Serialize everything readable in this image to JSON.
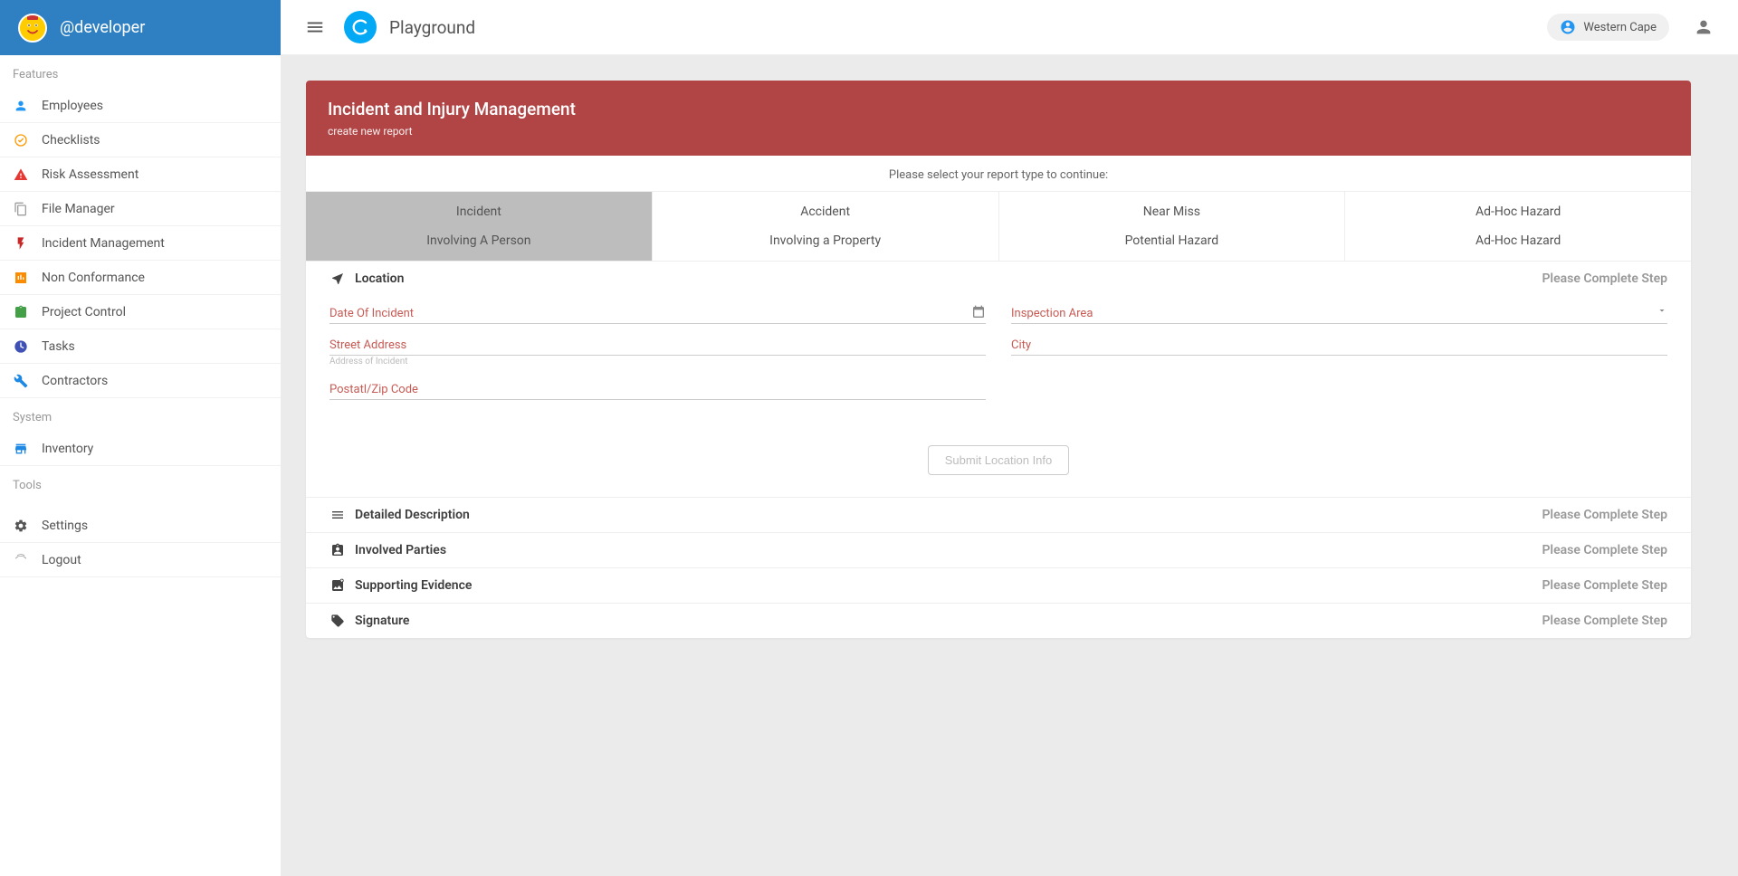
{
  "sidebar": {
    "username": "@developer",
    "sections": {
      "features_label": "Features",
      "system_label": "System",
      "tools_label": "Tools"
    },
    "items": {
      "employees": "Employees",
      "checklists": "Checklists",
      "risk": "Risk Assessment",
      "files": "File Manager",
      "incident": "Incident Management",
      "nonconf": "Non Conformance",
      "project": "Project Control",
      "tasks": "Tasks",
      "contractors": "Contractors",
      "inventory": "Inventory",
      "settings": "Settings",
      "logout": "Logout"
    }
  },
  "topbar": {
    "app_title": "Playground",
    "region": "Western Cape"
  },
  "card": {
    "title": "Incident and Injury Management",
    "subtitle": "create new report",
    "instruction": "Please select your report type to continue:"
  },
  "types": [
    {
      "title": "Incident",
      "sub": "Involving A Person"
    },
    {
      "title": "Accident",
      "sub": "Involving a Property"
    },
    {
      "title": "Near Miss",
      "sub": "Potential Hazard"
    },
    {
      "title": "Ad-Hoc Hazard",
      "sub": "Ad-Hoc Hazard"
    }
  ],
  "steps": {
    "location": {
      "title": "Location",
      "status": "Please Complete Step"
    },
    "description": {
      "title": "Detailed Description",
      "status": "Please Complete Step"
    },
    "parties": {
      "title": "Involved Parties",
      "status": "Please Complete Step"
    },
    "evidence": {
      "title": "Supporting Evidence",
      "status": "Please Complete Step"
    },
    "signature": {
      "title": "Signature",
      "status": "Please Complete Step"
    }
  },
  "form": {
    "date_label": "Date Of Incident",
    "area_label": "Inspection Area",
    "street_label": "Street Address",
    "street_helper": "Address of Incident",
    "city_label": "City",
    "zip_label": "Postatl/Zip Code",
    "submit_label": "Submit Location Info"
  }
}
